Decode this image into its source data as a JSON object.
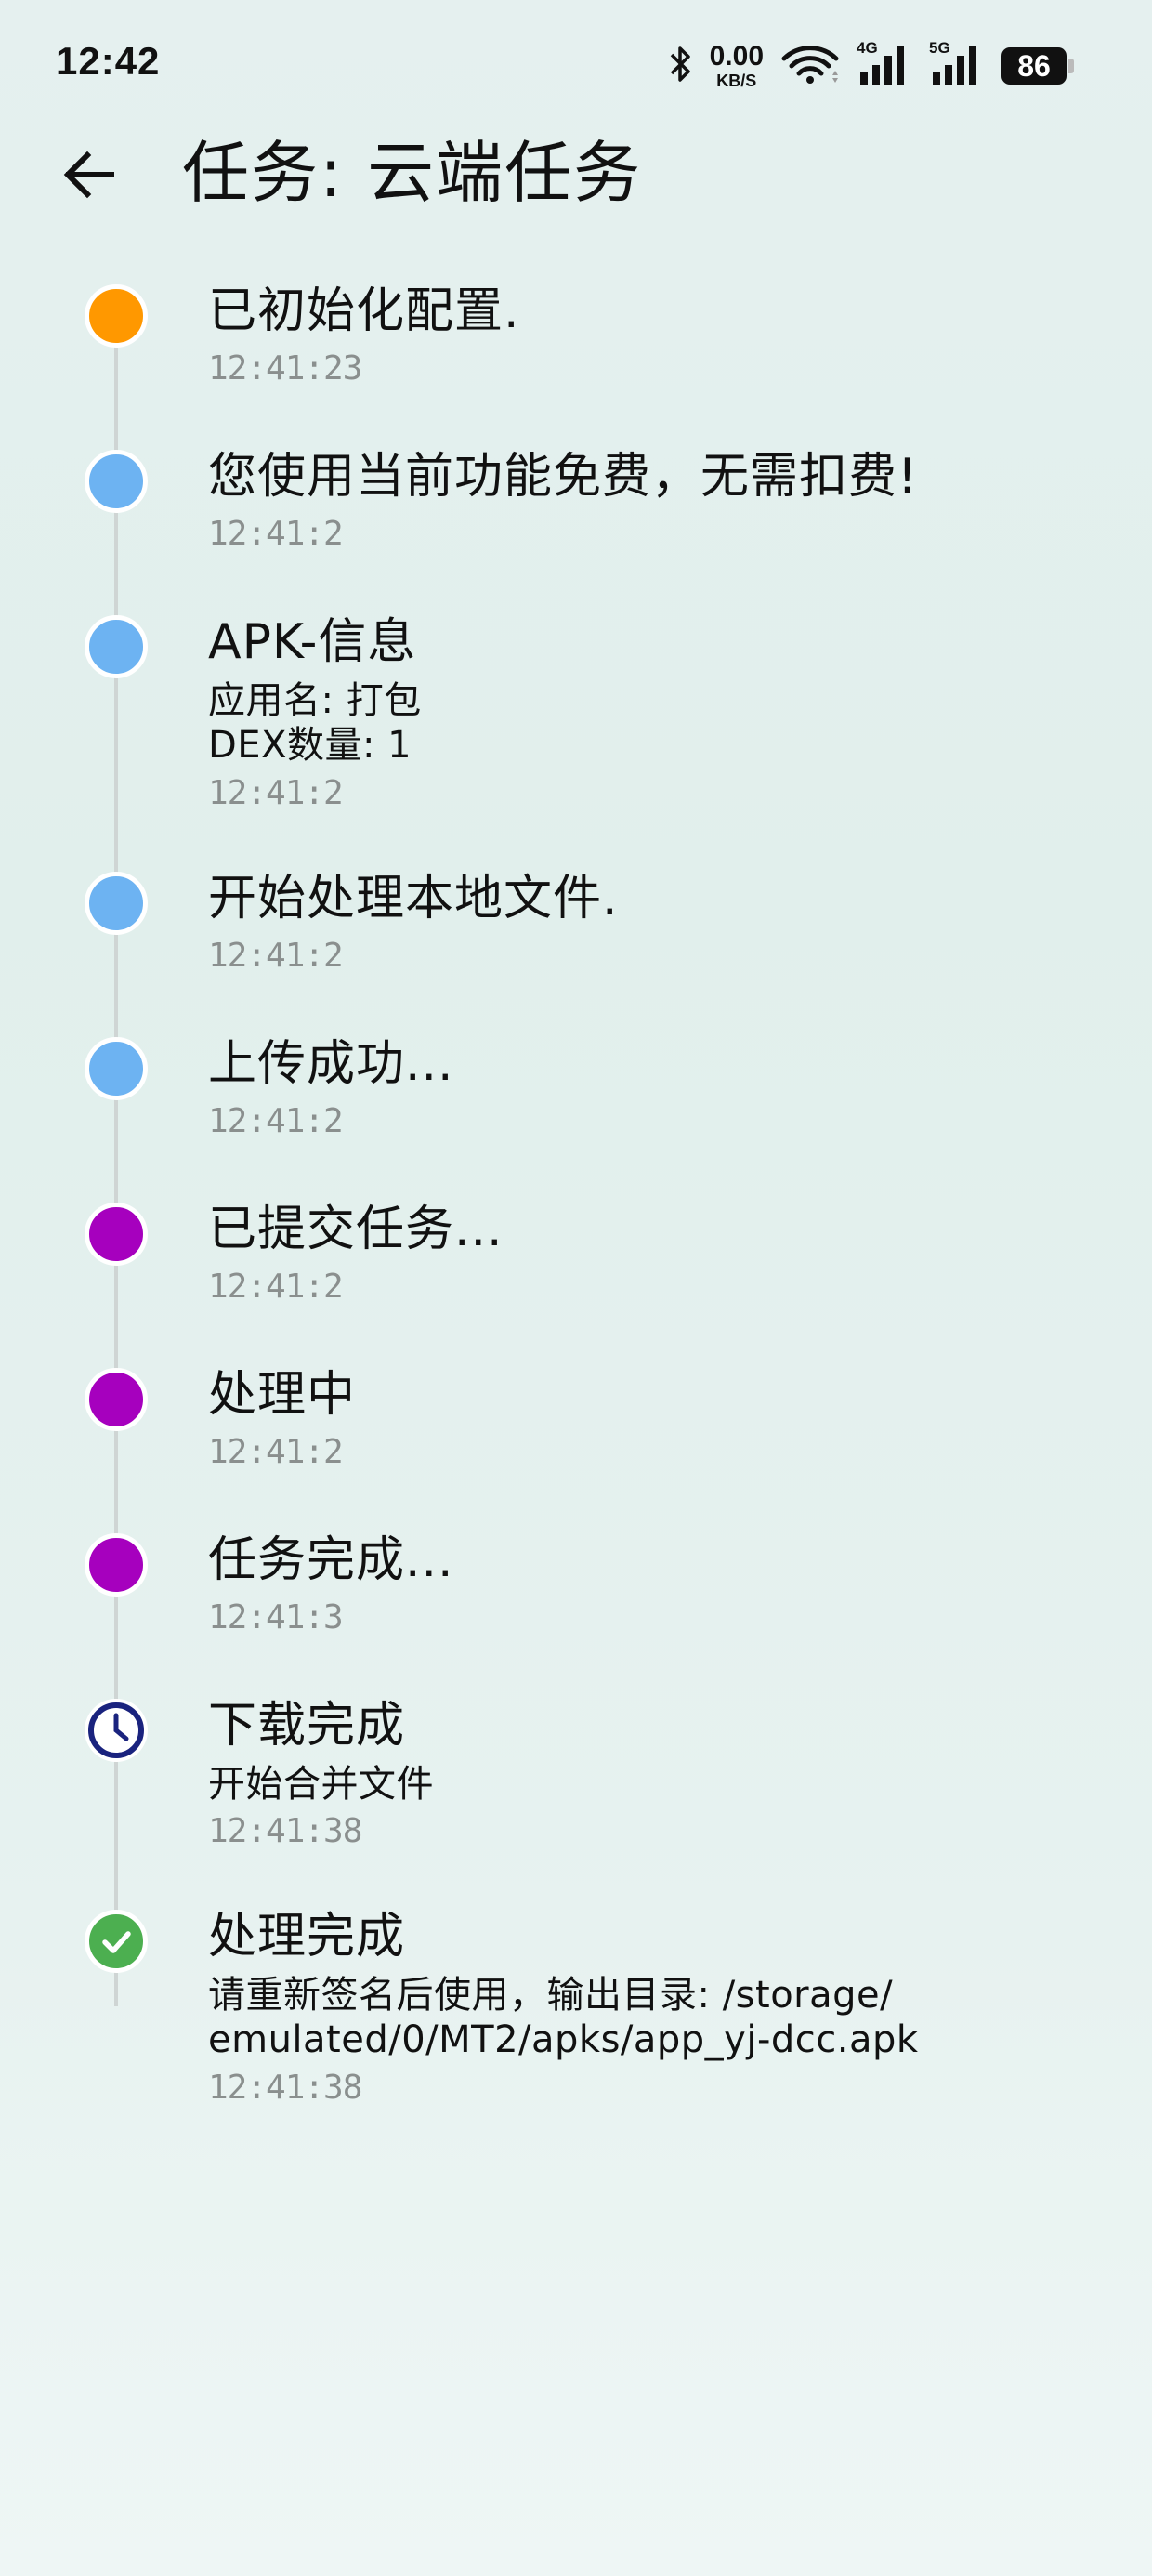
{
  "status_bar": {
    "time": "12:42",
    "net_speed_value": "0.00",
    "net_speed_unit": "KB/S",
    "signal1_tag": "4G",
    "signal2_tag": "5G",
    "battery": "86",
    "icons": [
      "bluetooth-icon",
      "wifi-icon",
      "signal-4g-icon",
      "signal-5g-icon",
      "battery-icon"
    ]
  },
  "header": {
    "back_icon": "arrow-left-icon",
    "title": "任务: 云端任务"
  },
  "colors": {
    "orange": "#FF9800",
    "blue": "#6DB3F2",
    "purple": "#A600BE",
    "navy": "#1A237E",
    "green": "#4CAF50",
    "time_gray": "#8a8f8e"
  },
  "timeline": [
    {
      "title": "已初始化配置.",
      "details": [],
      "time": "12:41:23",
      "dot": "orange"
    },
    {
      "title": "您使用当前功能免费，无需扣费!",
      "details": [],
      "time": "12:41:2",
      "dot": "blue"
    },
    {
      "title": "APK-信息",
      "details": [
        "应用名: 打包",
        "DEX数量: 1"
      ],
      "time": "12:41:2",
      "dot": "blue"
    },
    {
      "title": "开始处理本地文件.",
      "details": [],
      "time": "12:41:2",
      "dot": "blue"
    },
    {
      "title": "上传成功...",
      "details": [],
      "time": "12:41:2",
      "dot": "blue"
    },
    {
      "title": "已提交任务...",
      "details": [],
      "time": "12:41:2",
      "dot": "purple"
    },
    {
      "title": "处理中",
      "details": [],
      "time": "12:41:2",
      "dot": "purple"
    },
    {
      "title": "任务完成...",
      "details": [],
      "time": "12:41:3",
      "dot": "purple"
    },
    {
      "title": "下载完成",
      "details": [
        "开始合并文件"
      ],
      "time": "12:41:38",
      "dot": "clock"
    },
    {
      "title": "处理完成",
      "details": [
        "请重新签名后使用，输出目录: /storage/",
        "emulated/0/MT2/apks/app_yj-dcc.apk"
      ],
      "time": "12:41:38",
      "dot": "check"
    }
  ]
}
